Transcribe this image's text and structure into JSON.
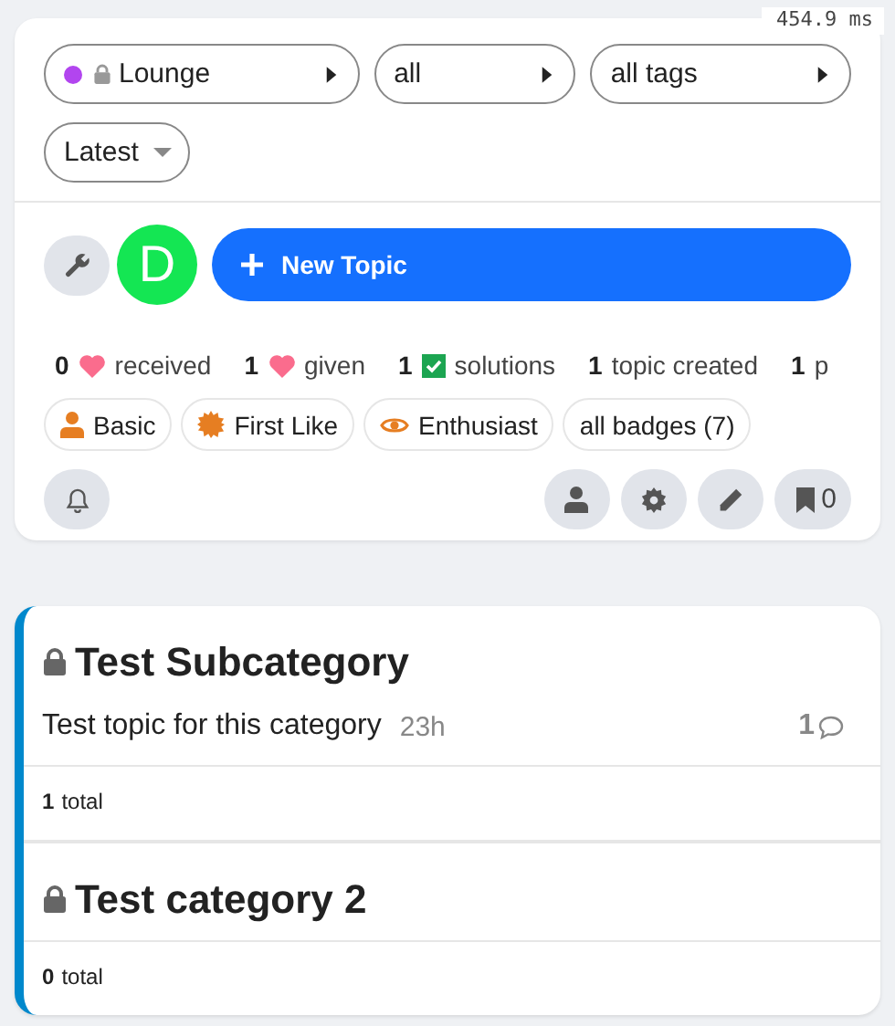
{
  "timing": "454.9 ms",
  "filters": [
    {
      "kind": "category",
      "label": "Lounge",
      "color": "#b245ef",
      "locked": true
    },
    {
      "kind": "plain",
      "label": "all"
    },
    {
      "kind": "plain",
      "label": "all tags"
    }
  ],
  "sort": {
    "label": "Latest"
  },
  "user": {
    "initial": "D",
    "color": "#14e653"
  },
  "new_topic": {
    "label": "New Topic"
  },
  "stats": [
    {
      "count": "0",
      "kind": "heart",
      "label": "received"
    },
    {
      "count": "1",
      "kind": "heart",
      "label": "given"
    },
    {
      "count": "1",
      "kind": "check",
      "label": "solutions"
    },
    {
      "count": "1",
      "kind": "plain",
      "label": "topic created"
    },
    {
      "count": "1",
      "kind": "plain",
      "label": "p"
    }
  ],
  "badges": [
    {
      "kind": "person",
      "label": "Basic"
    },
    {
      "kind": "burst",
      "label": "First Like"
    },
    {
      "kind": "eye",
      "label": "Enthusiast"
    },
    {
      "kind": "plain",
      "label": "all badges (7)"
    }
  ],
  "bookmarks": {
    "count": "0"
  },
  "categories": [
    {
      "name": "Test Subcategory",
      "locked": true,
      "topics": [
        {
          "title": "Test topic for this category",
          "age": "23h",
          "replies": "1"
        }
      ],
      "total_count": "1",
      "total_label": "total"
    },
    {
      "name": "Test category 2",
      "locked": true,
      "total_count": "0",
      "total_label": "total"
    }
  ]
}
